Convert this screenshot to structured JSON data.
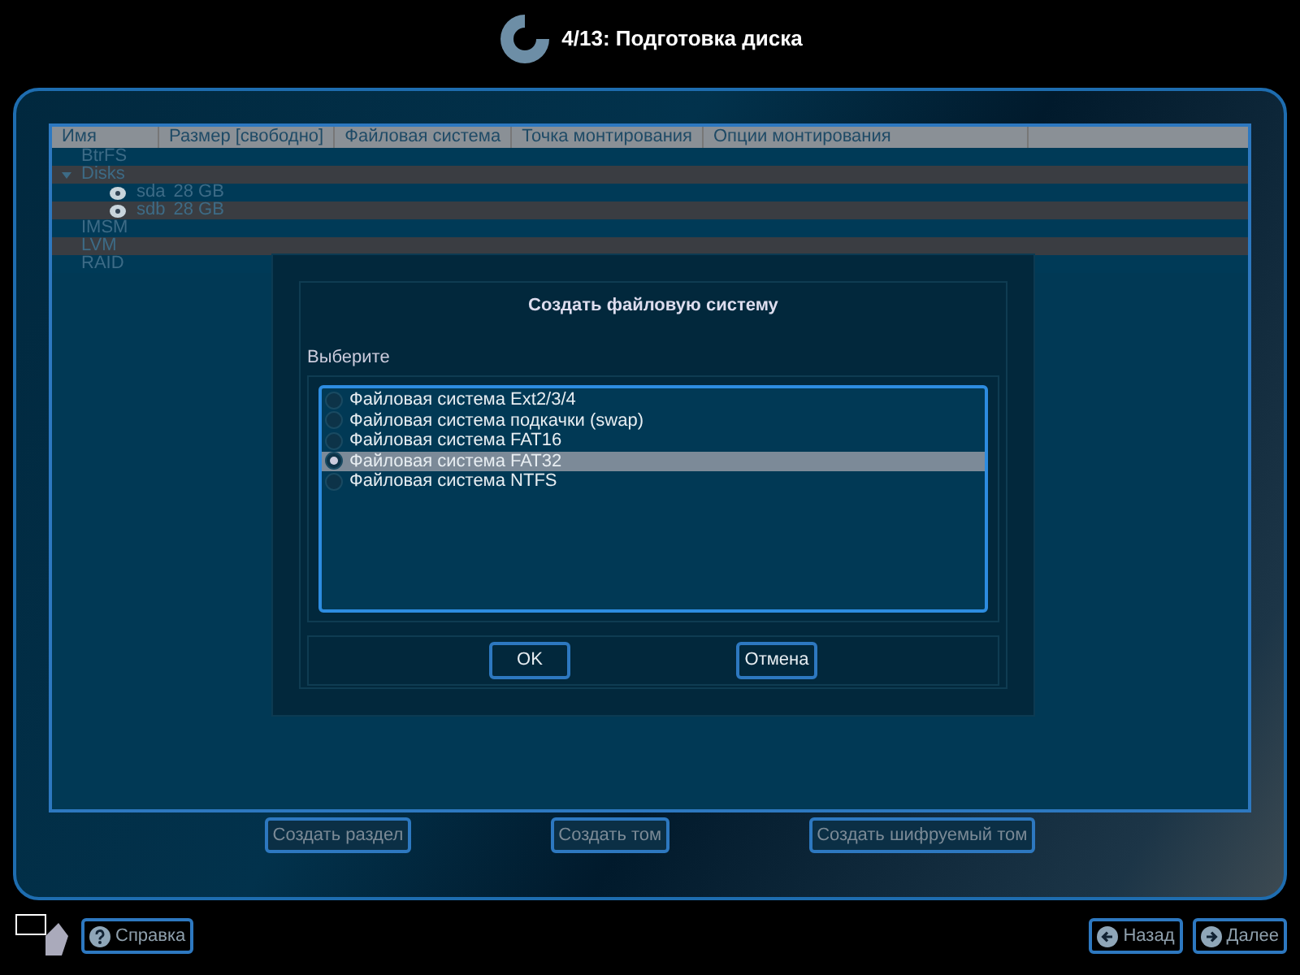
{
  "window": {
    "title": "4/13: Подготовка диска"
  },
  "table": {
    "columns": [
      "Имя",
      "Размер [свободно]",
      "Файловая система",
      "Точка монтирования",
      "Опции монтирования"
    ],
    "rows": [
      {
        "name": "BtrFS"
      },
      {
        "name": "Disks",
        "expanded": true,
        "children": [
          {
            "name": "sda",
            "size": "28 GB"
          },
          {
            "name": "sdb",
            "size": "28 GB"
          }
        ]
      },
      {
        "name": "IMSM"
      },
      {
        "name": "LVM"
      },
      {
        "name": "RAID"
      }
    ]
  },
  "actions": [
    "Создать раздел",
    "Создать том",
    "Создать шифруемый том"
  ],
  "dialog": {
    "title": "Создать файловую систему",
    "label": "Выберите",
    "options": [
      {
        "label": "Файловая система Ext2/3/4",
        "selected": false
      },
      {
        "label": "Файловая система подкачки (swap)",
        "selected": false
      },
      {
        "label": "Файловая система FAT16",
        "selected": false
      },
      {
        "label": "Файловая система FAT32",
        "selected": true
      },
      {
        "label": "Файловая система NTFS",
        "selected": false
      }
    ],
    "buttons": [
      "OK",
      "Отмена"
    ]
  },
  "footer": {
    "help": "Справка",
    "back": "Назад",
    "next": "Далее"
  }
}
